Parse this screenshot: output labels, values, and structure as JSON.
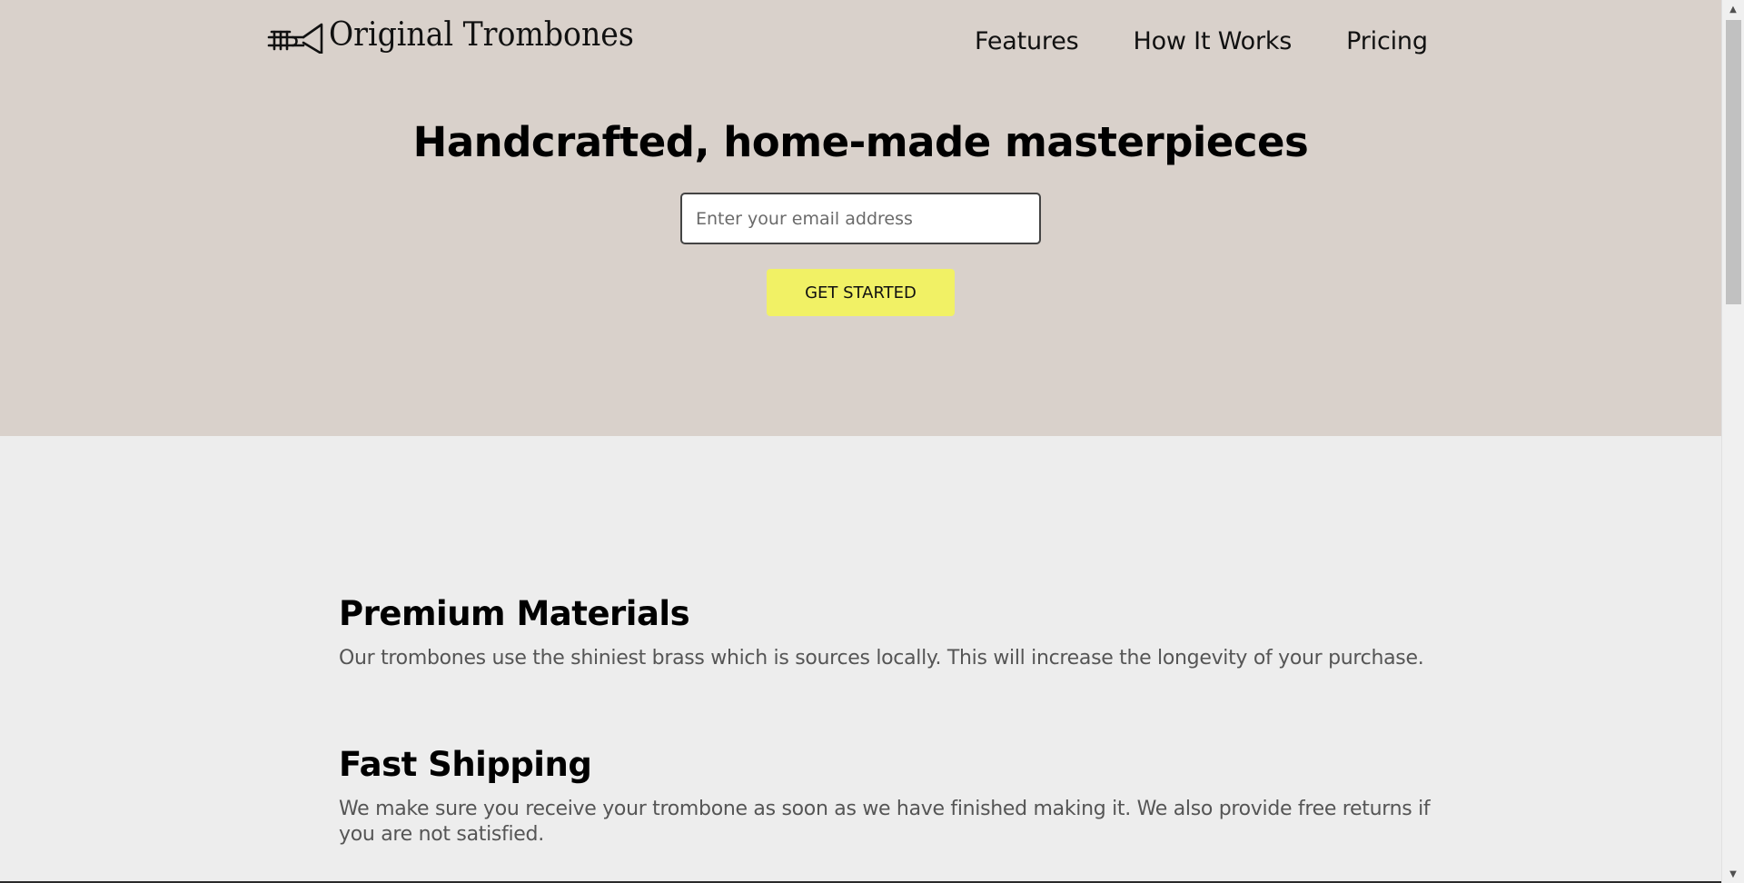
{
  "brand": {
    "name": "Original Trombones",
    "logo_icon": "trombone-icon"
  },
  "nav": {
    "items": [
      "Features",
      "How It Works",
      "Pricing"
    ]
  },
  "hero": {
    "headline": "Handcrafted, home-made masterpieces",
    "email_placeholder": "Enter your email address",
    "cta_label": "GET STARTED"
  },
  "features": [
    {
      "title": "Premium Materials",
      "text": "Our trombones use the shiniest brass which is sources locally. This will increase the longevity of your purchase."
    },
    {
      "title": "Fast Shipping",
      "text": "We make sure you receive your trombone as soon as we have finished making it. We also provide free returns if you are not satisfied."
    }
  ],
  "colors": {
    "hero_bg": "#d9d1cb",
    "page_bg": "#ededed",
    "cta_bg": "#f1f165"
  }
}
